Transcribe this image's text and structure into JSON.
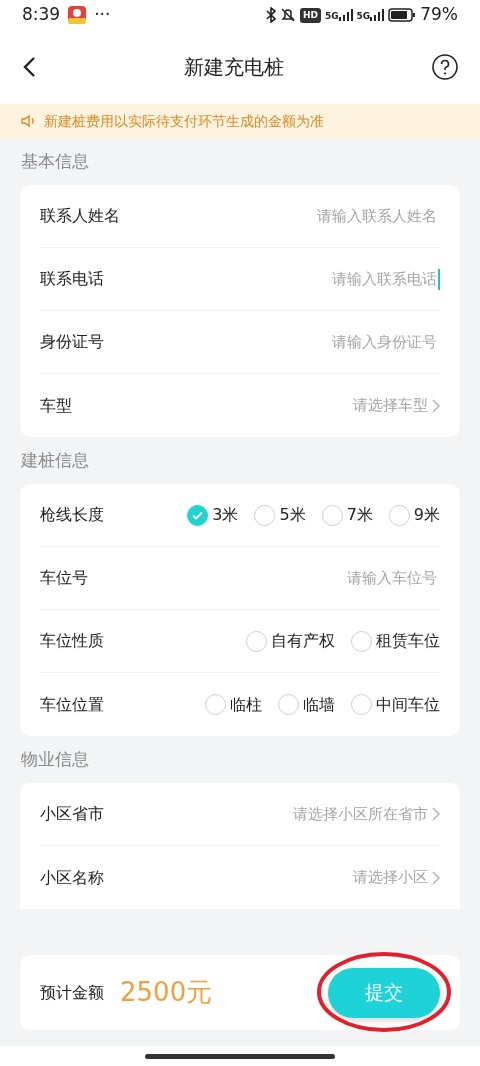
{
  "status_bar": {
    "time": "8:39",
    "more": "···",
    "hd": "HD",
    "networks": [
      "5G",
      "5G"
    ],
    "battery_text": "79%"
  },
  "header": {
    "title": "新建充电桩"
  },
  "notice": {
    "text": "新建桩费用以实际待支付环节生成的金额为准"
  },
  "sections": [
    {
      "title": "基本信息",
      "rows": [
        {
          "kind": "input",
          "label": "联系人姓名",
          "placeholder": "请输入联系人姓名",
          "focused": false
        },
        {
          "kind": "input",
          "label": "联系电话",
          "placeholder": "请输入联系电话",
          "focused": true
        },
        {
          "kind": "input",
          "label": "身份证号",
          "placeholder": "请输入身份证号",
          "focused": false
        },
        {
          "kind": "select",
          "label": "车型",
          "placeholder": "请选择车型"
        }
      ]
    },
    {
      "title": "建桩信息",
      "rows": [
        {
          "kind": "radio",
          "label": "枪线长度",
          "options": [
            {
              "label": "3米",
              "selected": true
            },
            {
              "label": "5米",
              "selected": false
            },
            {
              "label": "7米",
              "selected": false
            },
            {
              "label": "9米",
              "selected": false
            }
          ]
        },
        {
          "kind": "input",
          "label": "车位号",
          "placeholder": "请输入车位号",
          "focused": false
        },
        {
          "kind": "radio",
          "label": "车位性质",
          "options": [
            {
              "label": "自有产权",
              "selected": false
            },
            {
              "label": "租赁车位",
              "selected": false
            }
          ]
        },
        {
          "kind": "radio",
          "label": "车位位置",
          "options": [
            {
              "label": "临柱",
              "selected": false
            },
            {
              "label": "临墙",
              "selected": false
            },
            {
              "label": "中间车位",
              "selected": false
            }
          ]
        }
      ]
    },
    {
      "title": "物业信息",
      "rows": [
        {
          "kind": "select",
          "label": "小区省市",
          "placeholder": "请选择小区所在省市"
        },
        {
          "kind": "select",
          "label": "小区名称",
          "placeholder": "请选择小区"
        }
      ]
    }
  ],
  "footer": {
    "label": "预计金额",
    "amount": "2500元",
    "button": "提交"
  },
  "annotation": {
    "kind": "ellipse",
    "color": "#e0202a"
  }
}
